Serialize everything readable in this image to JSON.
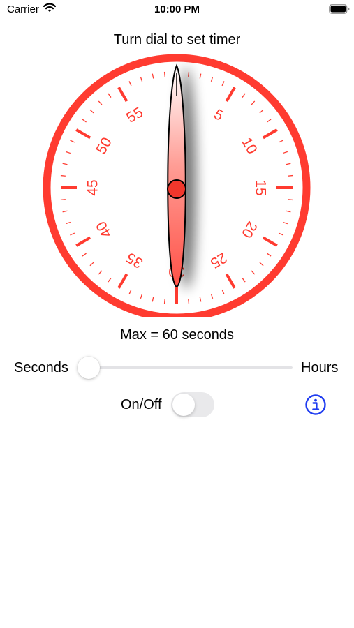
{
  "status_bar": {
    "carrier": "Carrier",
    "time": "10:00 PM"
  },
  "instruction": "Turn dial to set timer",
  "dial": {
    "numbers": [
      "5",
      "10",
      "15",
      "20",
      "25",
      "30",
      "35",
      "40",
      "45",
      "50",
      "55"
    ],
    "max_value": 60,
    "current_value": 0,
    "accent_color": "#ff3b30"
  },
  "max_label": "Max = 60 seconds",
  "unit_slider": {
    "left_label": "Seconds",
    "right_label": "Hours",
    "value": 0
  },
  "power": {
    "label": "On/Off",
    "on": false
  },
  "info_icon": "info-circle-icon"
}
